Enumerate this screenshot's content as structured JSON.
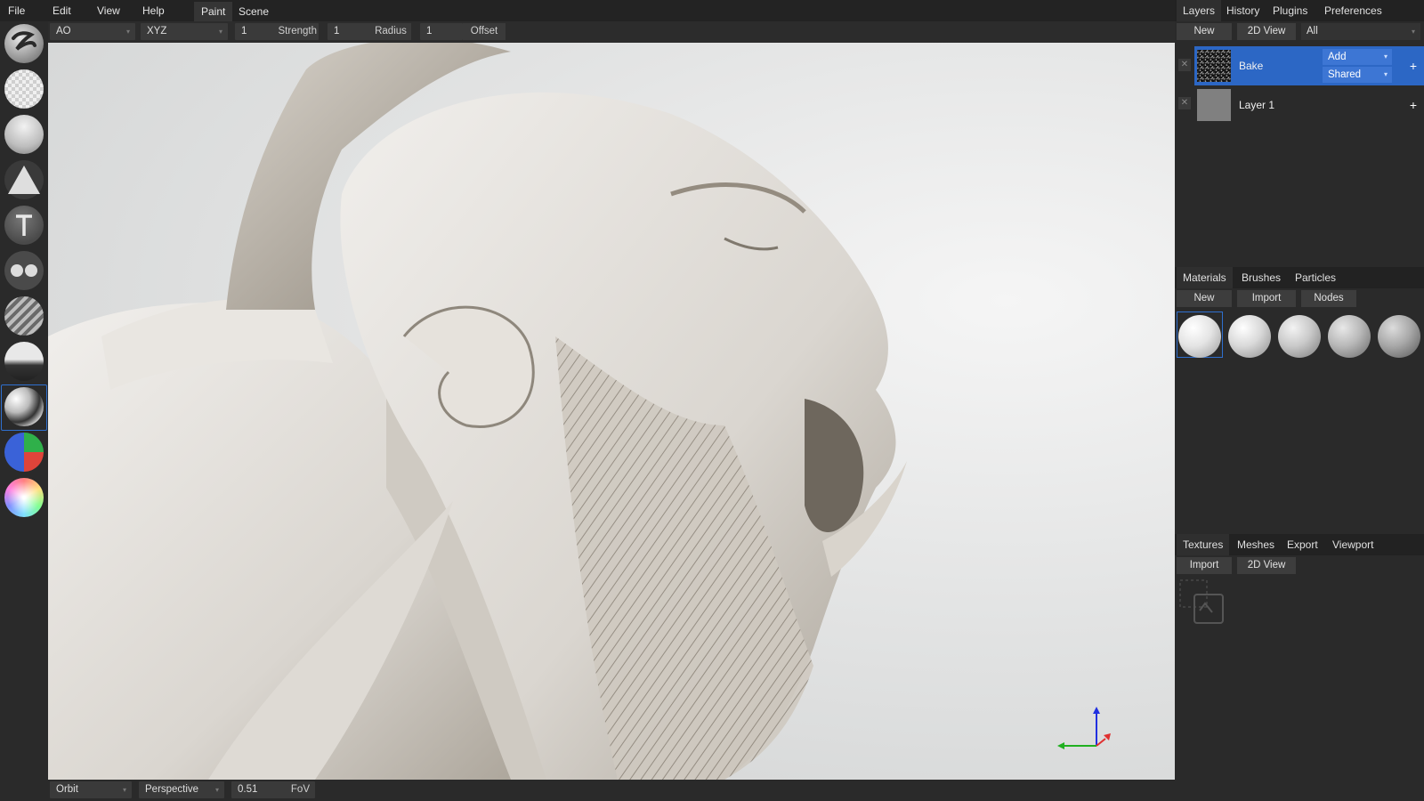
{
  "menu": {
    "file": "File",
    "edit": "Edit",
    "view": "View",
    "help": "Help"
  },
  "workspace_tabs": {
    "paint": "Paint",
    "scene": "Scene"
  },
  "tool_options": {
    "bake_type": "AO",
    "axis": "XYZ",
    "strength_value": "1",
    "strength_label": "Strength",
    "radius_value": "1",
    "radius_label": "Radius",
    "offset_value": "1",
    "offset_label": "Offset"
  },
  "toolbar": {
    "tools": [
      "brush",
      "eraser",
      "fill",
      "decal",
      "text",
      "clone",
      "blur",
      "particle",
      "bake",
      "colorid",
      "picker"
    ],
    "active_tool": "bake"
  },
  "bottom_bar": {
    "camera_mode": "Orbit",
    "projection": "Perspective",
    "fov_value": "0.51",
    "fov_label": "FoV"
  },
  "layers_panel": {
    "tabs": [
      "Layers",
      "History",
      "Plugins",
      "Preferences"
    ],
    "new_button": "New",
    "view2d_button": "2D View",
    "filter": "All",
    "layers": [
      {
        "name": "Bake",
        "blending": "Add",
        "object": "Shared",
        "selected": true
      },
      {
        "name": "Layer 1",
        "selected": false
      }
    ]
  },
  "materials_panel": {
    "tabs": [
      "Materials",
      "Brushes",
      "Particles"
    ],
    "new_button": "New",
    "import_button": "Import",
    "nodes_button": "Nodes",
    "material_count": 5
  },
  "textures_panel": {
    "tabs": [
      "Textures",
      "Meshes",
      "Export",
      "Viewport"
    ],
    "import_button": "Import",
    "view2d_button": "2D View"
  },
  "colors": {
    "accent": "#2c67c5",
    "background": "#2a2a2a",
    "panel": "#262626",
    "field": "#3a3a3a",
    "axis_x": "#e03030",
    "axis_y": "#20b020",
    "axis_z": "#2030e0"
  }
}
